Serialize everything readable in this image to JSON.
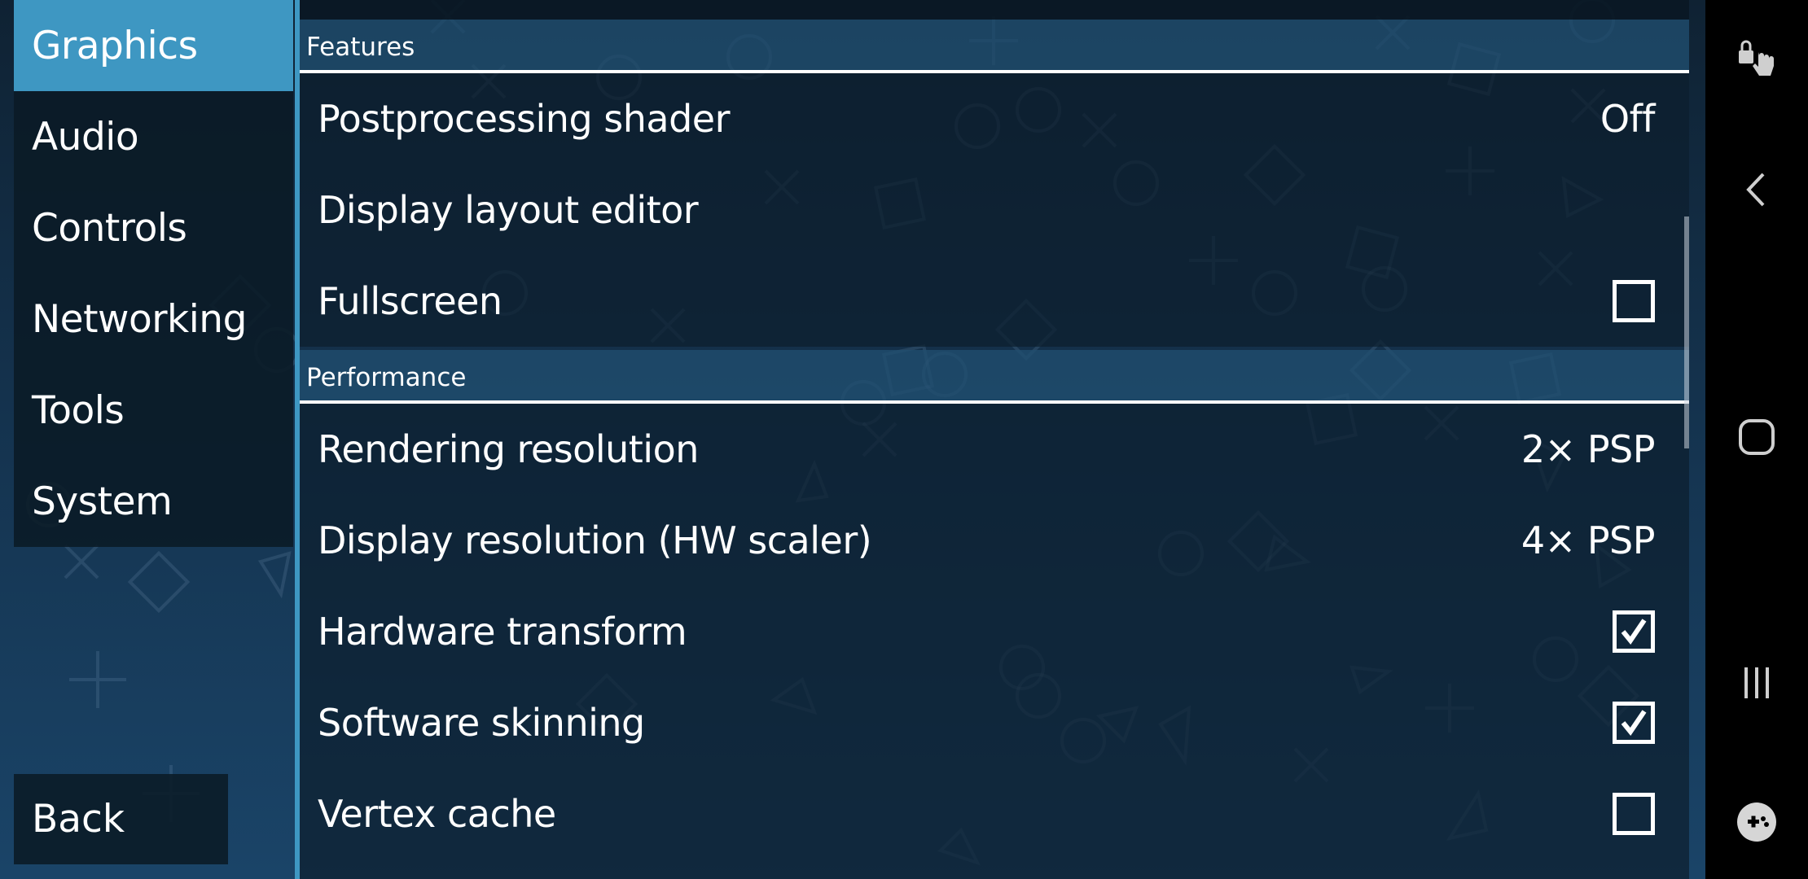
{
  "sidebar": {
    "tabs": [
      {
        "label": "Graphics",
        "active": true
      },
      {
        "label": "Audio",
        "active": false
      },
      {
        "label": "Controls",
        "active": false
      },
      {
        "label": "Networking",
        "active": false
      },
      {
        "label": "Tools",
        "active": false
      },
      {
        "label": "System",
        "active": false
      }
    ],
    "back_label": "Back"
  },
  "sections": {
    "features": {
      "title": "Features",
      "items": [
        {
          "label": "Postprocessing shader",
          "value": "Off"
        },
        {
          "label": "Display layout editor"
        },
        {
          "label": "Fullscreen",
          "checked": false
        }
      ]
    },
    "performance": {
      "title": "Performance",
      "items": [
        {
          "label": "Rendering resolution",
          "value": "2× PSP"
        },
        {
          "label": "Display resolution (HW scaler)",
          "value": "4× PSP"
        },
        {
          "label": "Hardware transform",
          "checked": true
        },
        {
          "label": "Software skinning",
          "checked": true
        },
        {
          "label": "Vertex cache",
          "checked": false
        }
      ]
    }
  },
  "navbar": {
    "icons": [
      "touch-lock-icon",
      "back-chevron-icon",
      "home-icon",
      "recents-icon",
      "game-tools-icon"
    ]
  },
  "colors": {
    "accent": "#3e97c2",
    "background": "#14324d",
    "text": "#ffffff"
  }
}
